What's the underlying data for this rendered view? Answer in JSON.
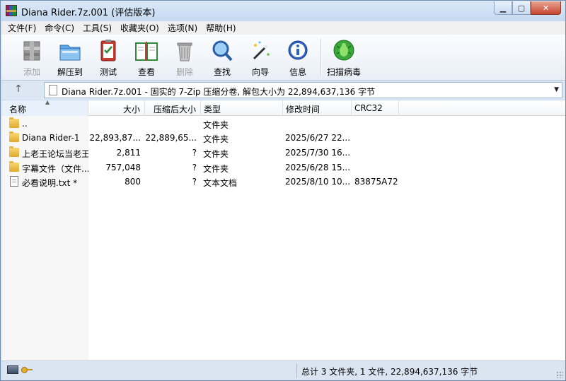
{
  "window": {
    "title": "Diana Rider.7z.001 (评估版本)",
    "controls": [
      "minimize",
      "maximize",
      "close"
    ]
  },
  "menu": [
    "文件(F)",
    "命令(C)",
    "工具(S)",
    "收藏夹(O)",
    "选项(N)",
    "帮助(H)"
  ],
  "toolbar": [
    {
      "label": "添加",
      "icon": "add-archive-icon",
      "enabled": false
    },
    {
      "label": "解压到",
      "icon": "extract-to-icon",
      "enabled": true
    },
    {
      "label": "测试",
      "icon": "test-icon",
      "enabled": true
    },
    {
      "label": "查看",
      "icon": "view-book-icon",
      "enabled": true
    },
    {
      "label": "删除",
      "icon": "delete-trash-icon",
      "enabled": false
    },
    {
      "label": "查找",
      "icon": "find-magnifier-icon",
      "enabled": true
    },
    {
      "label": "向导",
      "icon": "wizard-wand-icon",
      "enabled": true
    },
    {
      "label": "信息",
      "icon": "info-icon",
      "enabled": true
    },
    {
      "label": "扫描病毒",
      "icon": "virus-scan-icon",
      "enabled": true
    }
  ],
  "address": {
    "up_label": "↑",
    "path": "Diana Rider.7z.001 - 固实的 7-Zip 压缩分卷, 解包大小为 22,894,637,136 字节"
  },
  "columns": [
    "名称",
    "大小",
    "压缩后大小",
    "类型",
    "修改时间",
    "CRC32"
  ],
  "files": [
    {
      "name": "..",
      "size": "",
      "packed": "",
      "type": "文件夹",
      "modified": "",
      "crc": "",
      "kind": "folder"
    },
    {
      "name": "Diana Rider-1",
      "size": "22,893,87...",
      "packed": "22,889,65...",
      "type": "文件夹",
      "modified": "2025/6/27 22...",
      "crc": "",
      "kind": "folder"
    },
    {
      "name": "上老王论坛当老王",
      "size": "2,811",
      "packed": "?",
      "type": "文件夹",
      "modified": "2025/7/30 16...",
      "crc": "",
      "kind": "folder"
    },
    {
      "name": "字幕文件（文件...",
      "size": "757,048",
      "packed": "?",
      "type": "文件夹",
      "modified": "2025/6/28 15...",
      "crc": "",
      "kind": "folder"
    },
    {
      "name": "必看说明.txt *",
      "size": "800",
      "packed": "?",
      "type": "文本文档",
      "modified": "2025/8/10 10...",
      "crc": "83875A72",
      "kind": "file"
    }
  ],
  "status": {
    "summary": "总计 3 文件夹, 1 文件, 22,894,637,136 字节"
  }
}
